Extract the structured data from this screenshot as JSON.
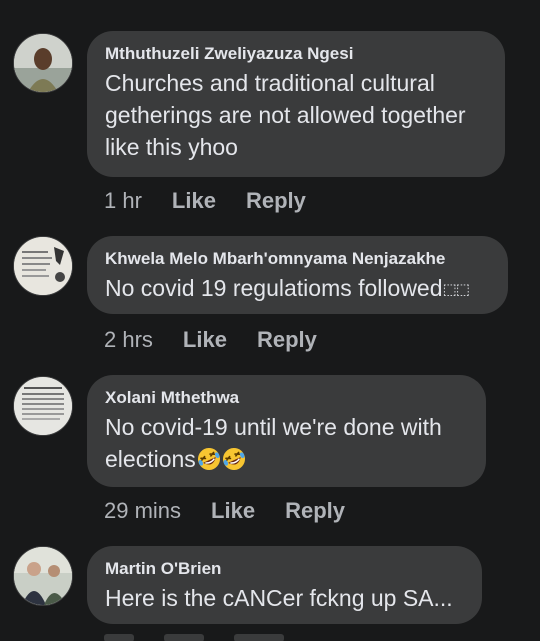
{
  "comments": [
    {
      "name": "Mthuthuzeli Zweliyazuza Ngesi",
      "lines": [
        "Churches and traditional cultural",
        "getherings are not allowed together",
        "like this yhoo"
      ],
      "time": "1 hr",
      "like": "Like",
      "reply": "Reply"
    },
    {
      "name": "Khwela Melo Mbarh'omnyama Nenjazakhe",
      "text": "No covid 19 regulatioms followed",
      "text_suffix": "⬚⬚",
      "time": "2 hrs",
      "like": "Like",
      "reply": "Reply"
    },
    {
      "name": "Xolani Mthethwa",
      "lines": [
        "No covid-19  until we're done with",
        "elections"
      ],
      "emoji": [
        "rolling-on-floor-laughing-emoji",
        "rolling-on-floor-laughing-emoji"
      ],
      "time": "29 mins",
      "like": "Like",
      "reply": "Reply"
    },
    {
      "name": "Martin O'Brien",
      "text": "Here is the cANCer fckng up SA..."
    }
  ],
  "colors": {
    "background": "#18191a",
    "bubble": "#3a3b3c",
    "text": "#e4e6eb",
    "secondary": "#b0b3b8"
  }
}
